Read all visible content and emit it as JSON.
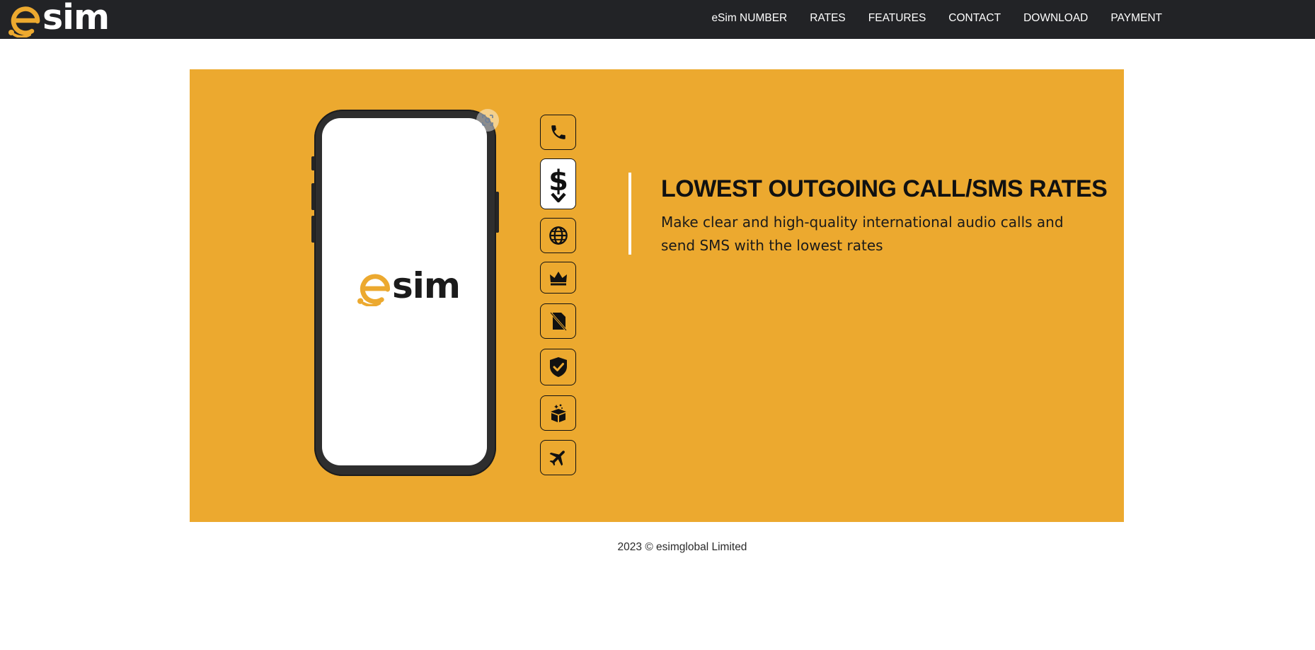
{
  "brand": {
    "logo_letter": "e",
    "logo_text": "sim",
    "accent_color": "#eca92f",
    "nav_bg_color": "#222326"
  },
  "nav": {
    "items": [
      {
        "label": "eSim NUMBER"
      },
      {
        "label": "RATES"
      },
      {
        "label": "FEATURES"
      },
      {
        "label": "CONTACT"
      },
      {
        "label": "DOWNLOAD"
      },
      {
        "label": "PAYMENT"
      }
    ]
  },
  "hero": {
    "phone_logo_letter": "e",
    "phone_logo_text": "sim",
    "feature_icons": [
      {
        "icon": "phone-icon",
        "selected": false
      },
      {
        "icon": "dollar-down-icon",
        "selected": true
      },
      {
        "icon": "globe-icon",
        "selected": false
      },
      {
        "icon": "crown-icon",
        "selected": false
      },
      {
        "icon": "no-sim-icon",
        "selected": false
      },
      {
        "icon": "shield-check-icon",
        "selected": false
      },
      {
        "icon": "gift-box-icon",
        "selected": false
      },
      {
        "icon": "airplane-icon",
        "selected": false
      }
    ],
    "feature": {
      "title": "LOWEST OUTGOING CALL/SMS RATES",
      "description": "Make clear and high-quality international audio calls and send SMS with the lowest rates"
    }
  },
  "footer": {
    "copyright": "2023 © esimglobal Limited"
  }
}
